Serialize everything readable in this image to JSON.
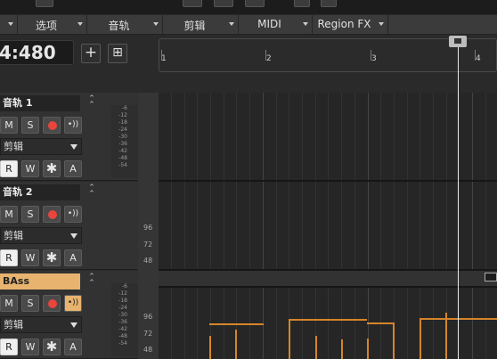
{
  "menubar": {
    "items": [
      {
        "label": "选项"
      },
      {
        "label": "音轨"
      },
      {
        "label": "剪辑"
      },
      {
        "label": "MIDI"
      },
      {
        "label": "Region FX"
      }
    ]
  },
  "transport": {
    "time": "4:480",
    "add_track_label": "+",
    "add_folder_label": "⊞"
  },
  "ruler": {
    "marks": [
      "1",
      "2",
      "3",
      "4"
    ]
  },
  "tracks": [
    {
      "name": "音轨 1",
      "mute": "M",
      "solo": "S",
      "clip_mode": "剪辑",
      "read": "R",
      "write": "W",
      "fx": "✱",
      "auto": "A"
    },
    {
      "name": "音轨 2",
      "mute": "M",
      "solo": "S",
      "clip_mode": "剪辑",
      "read": "R",
      "write": "W",
      "fx": "✱",
      "auto": "A"
    },
    {
      "name": "BAss",
      "mute": "M",
      "solo": "S",
      "clip_mode": "剪辑",
      "read": "R",
      "write": "W",
      "fx": "✱",
      "auto": "A"
    }
  ],
  "meter_scale": [
    "-6",
    "-12",
    "-18",
    "-24",
    "-30",
    "-36",
    "-42",
    "-48",
    "-54"
  ],
  "piano_roll_labels": [
    "96",
    "72",
    "48"
  ],
  "colors": {
    "accent_orange": "#e7b36e",
    "record_red": "#e8453c",
    "note_color": "#d5862a"
  },
  "icons": {
    "add": "plus-icon",
    "folder": "add-folder-icon",
    "input_echo": "input-echo-icon",
    "fx": "asterisk-icon"
  }
}
